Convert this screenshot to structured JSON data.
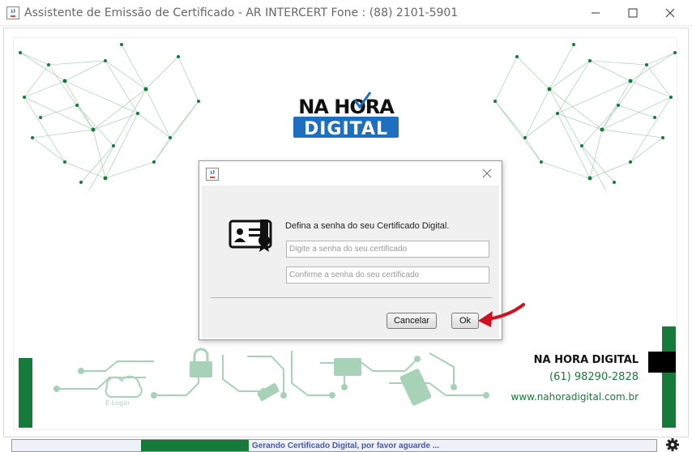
{
  "window": {
    "title": "Assistente de Emissão de Certificado - AR INTERCERT Fone : (88) 2101-5901",
    "controls": {
      "minimize": "minimize-icon",
      "maximize": "maximize-icon",
      "close": "close-icon"
    }
  },
  "brand": {
    "logo_top": "NA HORA",
    "logo_bottom": "DIGITAL",
    "company_name": "NA HORA DIGITAL",
    "phone": "(61) 98290-2828",
    "website": "www.nahoradigital.com.br",
    "accent_color": "#157a3a",
    "logo_blue": "#1e6fc0"
  },
  "decor": {
    "circuit_label": "E-Login"
  },
  "dialog": {
    "prompt": "Defina a senha do seu Certificado Digital.",
    "password_placeholder": "Digite a senha do seu certificado",
    "confirm_placeholder": "Confirme a senha do seu certificado",
    "cancel_label": "Cancelar",
    "ok_label": "Ok"
  },
  "status": {
    "text": "Gerando Certificado Digital, por favor aguarde ..."
  }
}
